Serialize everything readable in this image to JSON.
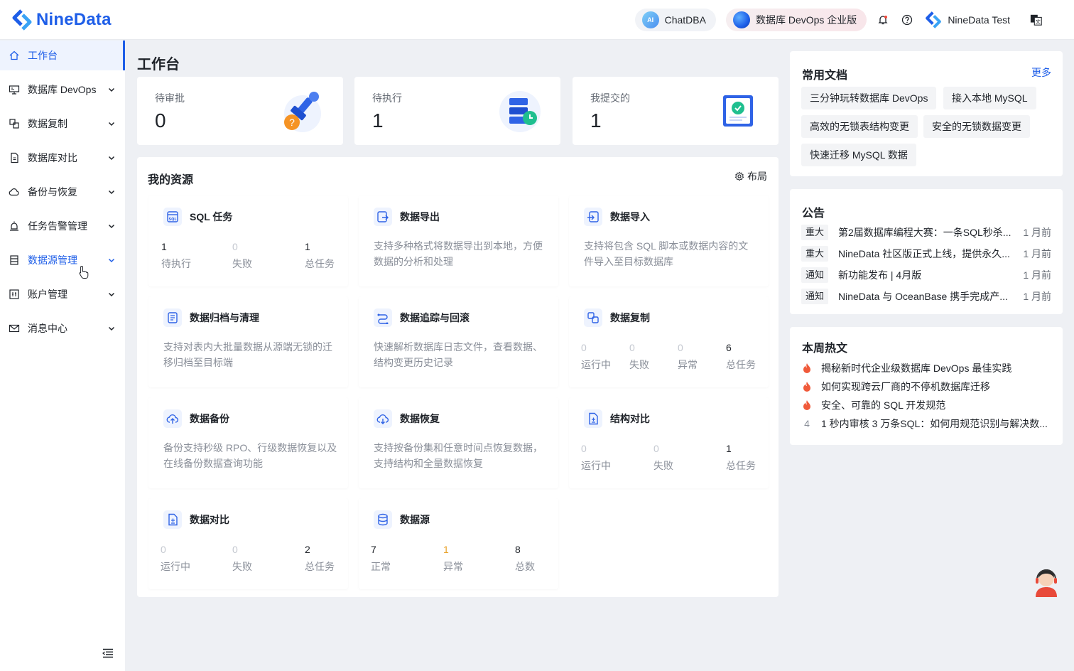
{
  "header": {
    "logo_text": "NineData",
    "chat_label": "ChatDBA",
    "chat_icon_text": "AI",
    "devops_label": "数据库 DevOps 企业版",
    "user_name": "NineData Test",
    "lang_icon_text": "文"
  },
  "sidebar": {
    "items": [
      {
        "label": "工作台",
        "icon": "home-icon"
      },
      {
        "label": "数据库 DevOps",
        "icon": "monitor-icon"
      },
      {
        "label": "数据复制",
        "icon": "copy-icon"
      },
      {
        "label": "数据库对比",
        "icon": "compare-icon"
      },
      {
        "label": "备份与恢复",
        "icon": "cloud-icon"
      },
      {
        "label": "任务告警管理",
        "icon": "alarm-icon"
      },
      {
        "label": "数据源管理",
        "icon": "datasource-icon"
      },
      {
        "label": "账户管理",
        "icon": "account-icon"
      },
      {
        "label": "消息中心",
        "icon": "mail-icon"
      }
    ]
  },
  "main": {
    "title": "工作台",
    "stats": [
      {
        "label": "待审批",
        "value": "0"
      },
      {
        "label": "待执行",
        "value": "1"
      },
      {
        "label": "我提交的",
        "value": "1"
      }
    ],
    "resources": {
      "title": "我的资源",
      "layout_label": "布局",
      "cards": {
        "sql": {
          "title": "SQL 任务",
          "metrics": [
            {
              "value": "1",
              "label": "待执行"
            },
            {
              "value": "0",
              "label": "失败"
            },
            {
              "value": "1",
              "label": "总任务"
            }
          ]
        },
        "export": {
          "title": "数据导出",
          "desc": "支持多种格式将数据导出到本地，方便数据的分析和处理"
        },
        "import": {
          "title": "数据导入",
          "desc": "支持将包含 SQL 脚本或数据内容的文件导入至目标数据库"
        },
        "archive": {
          "title": "数据归档与清理",
          "desc": "支持对表内大批量数据从源端无锁的迁移归档至目标端"
        },
        "trace": {
          "title": "数据追踪与回滚",
          "desc": "快速解析数据库日志文件，查看数据、结构变更历史记录"
        },
        "replication": {
          "title": "数据复制",
          "metrics": [
            {
              "value": "0",
              "label": "运行中"
            },
            {
              "value": "0",
              "label": "失败"
            },
            {
              "value": "0",
              "label": "异常"
            },
            {
              "value": "6",
              "label": "总任务"
            }
          ]
        },
        "backup": {
          "title": "数据备份",
          "desc": "备份支持秒级 RPO、行级数据恢复以及在线备份数据查询功能"
        },
        "restore": {
          "title": "数据恢复",
          "desc": "支持按备份集和任意时间点恢复数据，支持结构和全量数据恢复"
        },
        "schema_compare": {
          "title": "结构对比",
          "metrics": [
            {
              "value": "0",
              "label": "运行中"
            },
            {
              "value": "0",
              "label": "失败"
            },
            {
              "value": "1",
              "label": "总任务"
            }
          ]
        },
        "data_compare": {
          "title": "数据对比",
          "metrics": [
            {
              "value": "0",
              "label": "运行中"
            },
            {
              "value": "0",
              "label": "失败"
            },
            {
              "value": "2",
              "label": "总任务"
            }
          ]
        },
        "datasource": {
          "title": "数据源",
          "metrics": [
            {
              "value": "7",
              "label": "正常"
            },
            {
              "value": "1",
              "label": "异常"
            },
            {
              "value": "8",
              "label": "总数"
            }
          ]
        }
      }
    }
  },
  "docs": {
    "title": "常用文档",
    "more": "更多",
    "items": [
      "三分钟玩转数据库 DevOps",
      "接入本地 MySQL",
      "高效的无锁表结构变更",
      "安全的无锁数据变更",
      "快速迁移 MySQL 数据"
    ]
  },
  "notices": {
    "title": "公告",
    "items": [
      {
        "tag": "重大",
        "text": "第2届数据库编程大赛：一条SQL秒杀...",
        "date": "1 月前"
      },
      {
        "tag": "重大",
        "text": "NineData 社区版正式上线，提供永久...",
        "date": "1 月前"
      },
      {
        "tag": "通知",
        "text": "新功能发布 | 4月版",
        "date": "1 月前"
      },
      {
        "tag": "通知",
        "text": "NineData 与 OceanBase 携手完成产...",
        "date": "1 月前"
      }
    ]
  },
  "hot": {
    "title": "本周热文",
    "items": [
      {
        "rank": "",
        "text": "揭秘新时代企业级数据库 DevOps 最佳实践"
      },
      {
        "rank": "",
        "text": "如何实现跨云厂商的不停机数据库迁移"
      },
      {
        "rank": "",
        "text": "安全、可靠的 SQL 开发规范"
      },
      {
        "rank": "4",
        "text": "1 秒内审核 3 万条SQL：如何用规范识别与解决数..."
      }
    ]
  },
  "colors": {
    "primary": "#1e5ee8",
    "warning": "#e8a22a",
    "hot": "#f05a3a"
  }
}
